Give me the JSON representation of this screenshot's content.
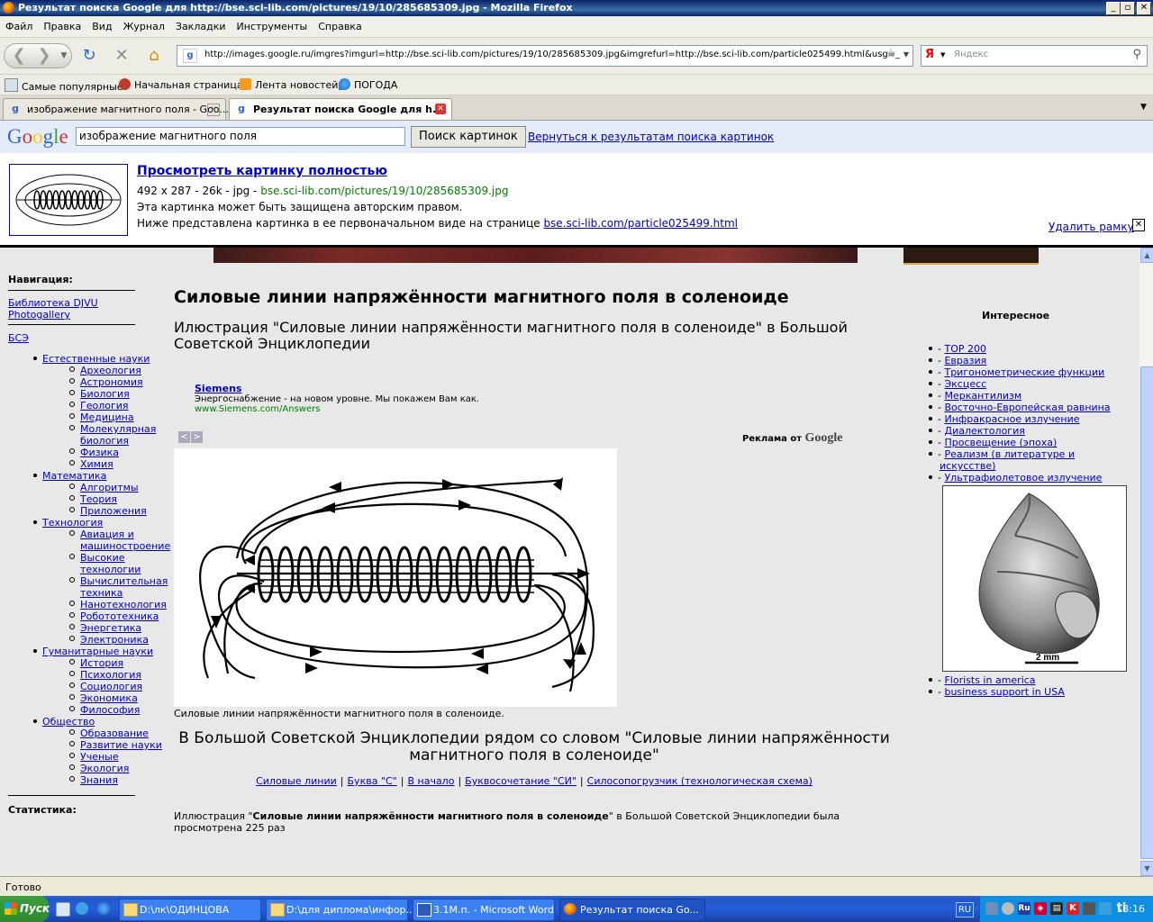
{
  "window": {
    "title": "Результат поиска Google для http://bse.sci-lib.com/pictures/19/10/285685309.jpg - Mozilla Firefox"
  },
  "menu": [
    "Файл",
    "Правка",
    "Вид",
    "Журнал",
    "Закладки",
    "Инструменты",
    "Справка"
  ],
  "address": {
    "url": "http://images.google.ru/imgres?imgurl=http://bse.sci-lib.com/pictures/19/10/285685309.jpg&imgrefurl=http://bse.sci-lib.com/particle025499.html&usg=_",
    "search_brand": "Я",
    "search_placeholder": "Яндекс"
  },
  "bookmarks": [
    "Самые популярные",
    "Начальная страница",
    "Лента новостей",
    "ПОГОДА"
  ],
  "tabs": [
    {
      "label": "изображение магнитного поля - Goo...",
      "active": false
    },
    {
      "label": "Результат поиска Google для h...",
      "active": true
    }
  ],
  "google": {
    "logo": "Google",
    "query": "изображение магнитного поля",
    "search_button": "Поиск картинок",
    "back_link": "Вернуться к результатам поиска картинок",
    "view_full": "Просмотреть картинку полностью",
    "meta": "492 x 287 - 26k - jpg - ",
    "meta_url": "bse.sci-lib.com/pictures/19/10/285685309.jpg",
    "copyright": "Эта картинка может быть защищена авторским правом.",
    "below_text": "Ниже представлена картинка в ее первоначальном виде на странице ",
    "below_link": "bse.sci-lib.com/particle025499.html",
    "remove_frame": "Удалить рамку",
    "remove_x": "✕"
  },
  "sidebar": {
    "nav_title": "Навигация:",
    "links_top": [
      "Библиотека DJVU",
      "Photogallery"
    ],
    "bse": "БСЭ",
    "categories": [
      {
        "label": "Естественные науки",
        "items": [
          "Археология",
          "Астрономия",
          "Биология",
          "Геология",
          "Медицина",
          "Молекулярная",
          "биология",
          "Физика",
          "Химия"
        ]
      },
      {
        "label": "Математика",
        "items": [
          "Алгоритмы",
          "Теория",
          "Приложения"
        ]
      },
      {
        "label": "Технология",
        "items": [
          "Авиация и",
          "машиностроение",
          "Высокие",
          "технологии",
          "Вычислительная",
          "техника",
          "Нанотехнология",
          "Робототехника",
          "Энергетика",
          "Электроника"
        ]
      },
      {
        "label": "Гуманитарные науки",
        "items": [
          "История",
          "Психология",
          "Социология",
          "Экономика",
          "Философия"
        ]
      },
      {
        "label": "Общество",
        "items": [
          "Образование",
          "Развитие науки",
          "Ученые",
          "Экология",
          "Знания"
        ]
      }
    ],
    "stats_title": "Статистика:"
  },
  "article": {
    "title": "Силовые линии напряжённости магнитного поля в соленоиде",
    "subtitle": "Илюстрация \"Силовые линии напряжённости магнитного поля в соленоиде\" в Большой Советской Энциклопедии",
    "ad_title": "Siemens",
    "ad_text": "Энергоснабжение - на новом уровне. Мы покажем Вам как.",
    "ad_url": "www.Siemens.com/Answers",
    "ads_by": "Реклама от",
    "ads_brand": "Google",
    "caption": "Силовые линии напряжённости магнитного поля в соленоиде.",
    "related_heading": "В Большой Советской Энциклопедии рядом со словом \"Силовые линии напряжённости магнитного поля в соленоиде\"",
    "related_links": [
      "Силовые линии",
      "Буква \"С\"",
      "В начало",
      "Буквосочетание \"СИ\"",
      "Силосопогрузчик (технологическая схема)"
    ],
    "stat_prefix": "Иллюстрация \"",
    "stat_bold": "Силовые линии напряжённости магнитного поля в соленоиде",
    "stat_suffix": "\" в Большой Советской Энциклопедии была просмотрена 225 раз"
  },
  "right": {
    "title": "Интересное",
    "links": [
      "TOP 200",
      "Евразия",
      "Тригонометрические функции",
      "Эксцесс",
      "Меркантилизм",
      "Восточно-Европейская равнина",
      "Инфракрасное излучение",
      "Диалектология",
      "Просвещение (эпоха)",
      "Реализм (в литературе и",
      "искусстве)",
      "Ультрафиолетовое излучение"
    ],
    "scale_label": "2 mm",
    "links2": [
      "Florists in america",
      "business support in USA"
    ]
  },
  "status": "Готово",
  "taskbar": {
    "start": "Пуск",
    "buttons": [
      "D:\\лк\\ОДИНЦОВА",
      "D:\\для диплома\\инфор...",
      "3.1М.п. - Microsoft Word",
      "Результат поиска Go..."
    ],
    "lang": "RU",
    "clock": "13:16"
  }
}
